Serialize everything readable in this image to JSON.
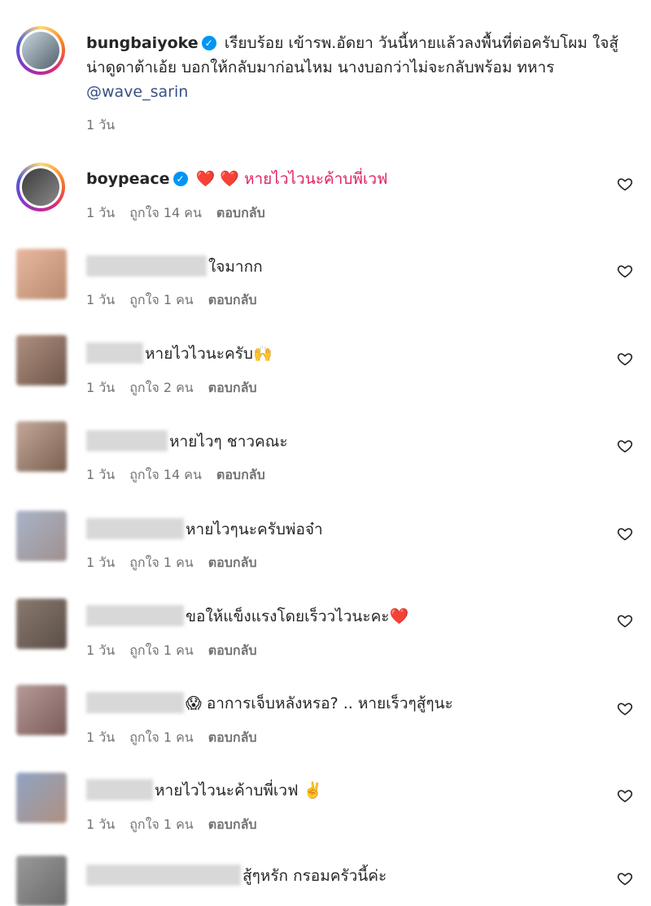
{
  "caption": {
    "username": "bungbaiyoke",
    "text": "เรียบร้อย เข้ารพ.อัดยา วันนี้หายแล้วลงพื้นที่ต่อครับโผม ใจสู้น่าดูดาต้าเอ้ย บอกให้กลับมาก่อนไหม นางบอกว่าไม่จะกลับพร้อม ทหาร",
    "mention": "@wave_sarin",
    "time": "1 วัน"
  },
  "comments": [
    {
      "username": "boypeace",
      "verified": true,
      "text": "❤️ ❤️ หายไวไวนะค้าบพี่เวฟ",
      "time": "1 วัน",
      "likes": "ถูกใจ 14 คน",
      "reply": "ตอบกลับ"
    },
    {
      "username": "",
      "text": "ใจมากก",
      "time": "1 วัน",
      "likes": "ถูกใจ 1 คน",
      "reply": "ตอบกลับ"
    },
    {
      "username": "",
      "text": "หายไวไวนะครับ🙌",
      "time": "1 วัน",
      "likes": "ถูกใจ 2 คน",
      "reply": "ตอบกลับ"
    },
    {
      "username": "",
      "text": "หายไวๆ ชาวคณะ",
      "time": "1 วัน",
      "likes": "ถูกใจ 14 คน",
      "reply": "ตอบกลับ"
    },
    {
      "username": "",
      "text": "หายไวๆนะครับพ่อจ๋า",
      "time": "1 วัน",
      "likes": "ถูกใจ 1 คน",
      "reply": "ตอบกลับ"
    },
    {
      "username": "",
      "text": "ขอให้แข็งแรงโดยเร็ววไวนะคะ❤️",
      "time": "1 วัน",
      "likes": "ถูกใจ 1 คน",
      "reply": "ตอบกลับ"
    },
    {
      "username": "",
      "text": "😱 อาการเจ็บหลังหรอ? .. หายเร็วๆสู้ๆนะ",
      "time": "1 วัน",
      "likes": "ถูกใจ 1 คน",
      "reply": "ตอบกลับ"
    },
    {
      "username": "",
      "text": "หายไวไวนะค้าบพี่เวฟ ✌️",
      "time": "1 วัน",
      "likes": "ถูกใจ 1 คน",
      "reply": "ตอบกลับ"
    },
    {
      "username": "",
      "text": "สู้ๆหรัก กรอมครัวนี้ค่ะ",
      "time": "",
      "likes": "",
      "reply": ""
    }
  ],
  "icons": {
    "like": "heart-outline-icon",
    "verified": "verified-badge-icon"
  },
  "colors": {
    "verified": "#0095f6",
    "mention": "#385185",
    "meta": "#737373"
  }
}
